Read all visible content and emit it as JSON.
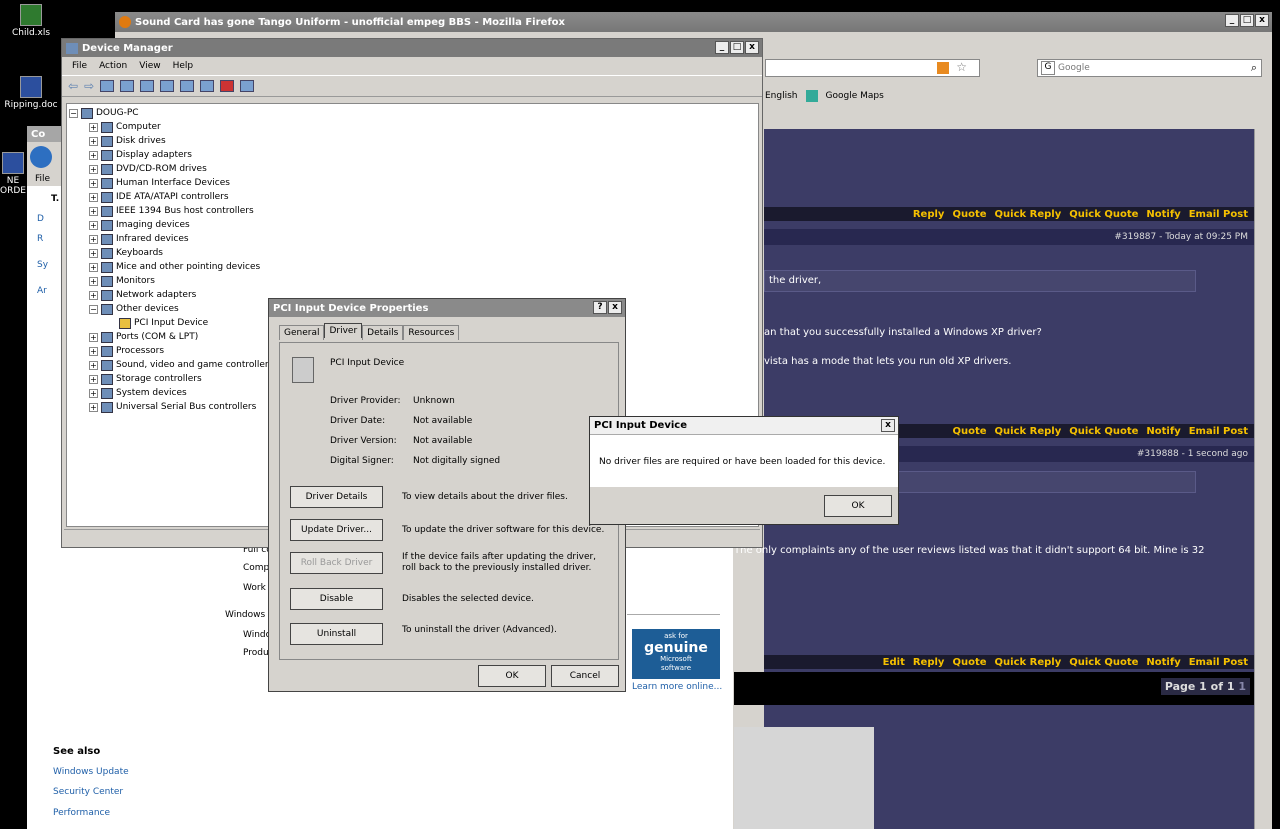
{
  "desktop": {
    "icons": [
      {
        "label": "Child.xls"
      },
      {
        "label": "Ripping.doc"
      },
      {
        "label": "NE"
      },
      {
        "label": "ORDE"
      }
    ]
  },
  "firefox": {
    "title": "Sound Card has gone Tango Uniform - unofficial empeg BBS - Mozilla Firefox",
    "search_placeholder": "Google",
    "bookmarks": [
      "English",
      "Google Maps"
    ]
  },
  "forum": {
    "actions1": [
      "Reply",
      "Quote",
      "Quick Reply",
      "Quick Quote",
      "Notify",
      "Email Post"
    ],
    "post1_header": "#319887 - Today at 09:25 PM",
    "post1_quote": "the driver,",
    "post1_lines": [
      "an that you successfully installed a Windows XP driver?",
      "vista has a mode that lets you run old XP drivers."
    ],
    "actions2": [
      "Quote",
      "Quick Reply",
      "Quick Quote",
      "Notify",
      "Email Post"
    ],
    "post2_header": "#319888 - 1 second ago",
    "post2_line": "The only complaints any of the user reviews listed was that it didn't support 64 bit. Mine is 32",
    "actions3": [
      "Edit",
      "Reply",
      "Quote",
      "Quick Reply",
      "Quick Quote",
      "Notify",
      "Email Post"
    ],
    "page_label": "Page 1 of 1",
    "page_num": "1"
  },
  "device_manager": {
    "title": "Device Manager",
    "menu": [
      "File",
      "Action",
      "View",
      "Help"
    ],
    "root": "DOUG-PC",
    "items": [
      "Computer",
      "Disk drives",
      "Display adapters",
      "DVD/CD-ROM drives",
      "Human Interface Devices",
      "IDE ATA/ATAPI controllers",
      "IEEE 1394 Bus host controllers",
      "Imaging devices",
      "Infrared devices",
      "Keyboards",
      "Mice and other pointing devices",
      "Monitors",
      "Network adapters",
      "Other devices",
      "PCI Input Device",
      "Ports (COM & LPT)",
      "Processors",
      "Sound, video and game controllers",
      "Storage controllers",
      "System devices",
      "Universal Serial Bus controllers"
    ]
  },
  "props": {
    "title": "PCI Input Device Properties",
    "tabs": [
      "General",
      "Driver",
      "Details",
      "Resources"
    ],
    "device_name": "PCI Input Device",
    "fields": [
      {
        "k": "Driver Provider:",
        "v": "Unknown"
      },
      {
        "k": "Driver Date:",
        "v": "Not available"
      },
      {
        "k": "Driver Version:",
        "v": "Not available"
      },
      {
        "k": "Digital Signer:",
        "v": "Not digitally signed"
      }
    ],
    "buttons": [
      {
        "label": "Driver Details",
        "desc": "To view details about the driver files."
      },
      {
        "label": "Update Driver...",
        "desc": "To update the driver software for this device."
      },
      {
        "label": "Roll Back Driver",
        "desc": "If the device fails after updating the driver, roll back to the previously installed driver."
      },
      {
        "label": "Disable",
        "desc": "Disables the selected device."
      },
      {
        "label": "Uninstall",
        "desc": "To uninstall the driver (Advanced)."
      }
    ],
    "ok": "OK",
    "cancel": "Cancel"
  },
  "msgbox": {
    "title": "PCI Input Device",
    "text": "No driver files are required or have been loaded for this device.",
    "ok": "OK"
  },
  "control_panel": {
    "partial_labels": [
      "Full co",
      "Comp",
      "Work",
      "Windows",
      "Windo",
      "Produ"
    ],
    "see_also": "See also",
    "links": [
      "Windows Update",
      "Security Center",
      "Performance"
    ],
    "genuine": [
      "ask for",
      "genuine",
      "Microsoft",
      "software"
    ],
    "learn_more": "Learn more online..."
  },
  "cp_back": {
    "title_partial": "Co",
    "file": "File",
    "heading": "T.",
    "side": [
      "D",
      "R",
      "Sy",
      "Ar"
    ]
  }
}
